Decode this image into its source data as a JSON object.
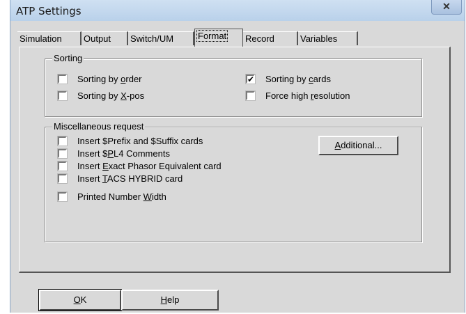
{
  "window": {
    "title": "ATP Settings",
    "close_glyph": "✕"
  },
  "tabs": [
    {
      "label": "Simulation"
    },
    {
      "label": "Output"
    },
    {
      "label": "Switch/UM"
    },
    {
      "label": "Format",
      "active": true
    },
    {
      "label": "Record"
    },
    {
      "label": "Variables"
    }
  ],
  "sorting": {
    "title": "Sorting",
    "items": [
      {
        "pre": "Sorting by ",
        "key": "o",
        "post": "rder",
        "checked": false
      },
      {
        "pre": "Sorting by ",
        "key": "c",
        "post": "ards",
        "checked": true
      },
      {
        "pre": "Sorting by ",
        "key": "X",
        "post": "-pos",
        "checked": false
      },
      {
        "pre": "Force high ",
        "key": "r",
        "post": "esolution",
        "checked": false
      }
    ]
  },
  "misc": {
    "title": "Miscellaneous request",
    "items": [
      {
        "pre": "Insert $Prefix and $Suffix cards",
        "key": "",
        "post": "",
        "checked": false
      },
      {
        "pre": "Insert $",
        "key": "P",
        "post": "L4 Comments",
        "checked": false
      },
      {
        "pre": "Insert ",
        "key": "E",
        "post": "xact Phasor Equivalent card",
        "checked": false
      },
      {
        "pre": "Insert ",
        "key": "T",
        "post": "ACS HYBRID card",
        "checked": false
      },
      {
        "pre": "Printed Number ",
        "key": "W",
        "post": "idth",
        "checked": false
      }
    ],
    "additional": {
      "pre": "",
      "key": "A",
      "post": "dditional..."
    }
  },
  "buttons": {
    "ok": {
      "pre": "",
      "key": "O",
      "post": "K"
    },
    "help": {
      "pre": "",
      "key": "H",
      "post": "elp"
    }
  }
}
